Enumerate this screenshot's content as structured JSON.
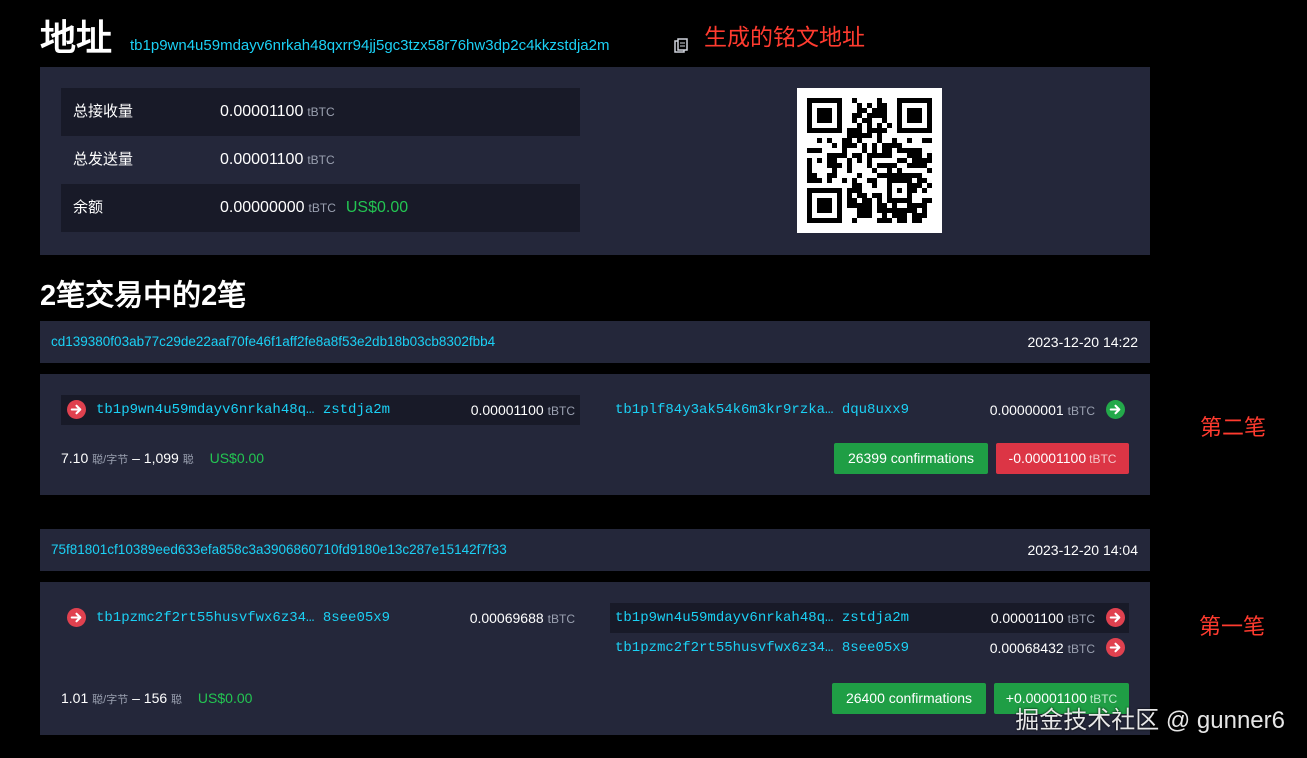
{
  "header": {
    "title": "地址",
    "address": "tb1p9wn4u59mdayv6nrkah48qxrr94jj5gc3tzx58r76hw3dp2c4kkzstdja2m",
    "annotation": "生成的铭文地址"
  },
  "summary": {
    "rows": [
      {
        "label": "总接收量",
        "value": "0.00001100",
        "unit": "tBTC",
        "usd": ""
      },
      {
        "label": "总发送量",
        "value": "0.00001100",
        "unit": "tBTC",
        "usd": ""
      },
      {
        "label": "余额",
        "value": "0.00000000",
        "unit": "tBTC",
        "usd": "US$0.00"
      }
    ]
  },
  "tx_heading": "2笔交易中的2笔",
  "transactions": [
    {
      "txid": "cd139380f03ab77c29de22aaf70fe46f1aff2fe8a8f53e2db18b03cb8302fbb4",
      "time": "2023-12-20 14:22",
      "inputs": [
        {
          "addr_head": "tb1p9wn4u59mdayv6nrkah48q…",
          "addr_tail": "zstdja2m",
          "amount": "0.00001100",
          "unit": "tBTC"
        }
      ],
      "outputs": [
        {
          "addr_head": "tb1plf84y3ak54k6m3kr9rzka…",
          "addr_tail": "dqu8uxx9",
          "amount": "0.00000001",
          "unit": "tBTC"
        }
      ],
      "fee_rate": "7.10",
      "fee_rate_unit": "聪/字节",
      "fee_sep": "–",
      "fee": "1,099",
      "fee_unit": "聪",
      "fee_usd": "US$0.00",
      "confirmations": "26399 confirmations",
      "delta": "-0.00001100",
      "delta_unit": "tBTC",
      "annotation": "第二笔"
    },
    {
      "txid": "75f81801cf10389eed633efa858c3a3906860710fd9180e13c287e15142f7f33",
      "time": "2023-12-20 14:04",
      "inputs": [
        {
          "addr_head": "tb1pzmc2f2rt55husvfwx6z34…",
          "addr_tail": "8see05x9",
          "amount": "0.00069688",
          "unit": "tBTC"
        }
      ],
      "outputs": [
        {
          "addr_head": "tb1p9wn4u59mdayv6nrkah48q…",
          "addr_tail": "zstdja2m",
          "amount": "0.00001100",
          "unit": "tBTC"
        },
        {
          "addr_head": "tb1pzmc2f2rt55husvfwx6z34…",
          "addr_tail": "8see05x9",
          "amount": "0.00068432",
          "unit": "tBTC"
        }
      ],
      "fee_rate": "1.01",
      "fee_rate_unit": "聪/字节",
      "fee_sep": "–",
      "fee": "156",
      "fee_unit": "聪",
      "fee_usd": "US$0.00",
      "confirmations": "26400 confirmations",
      "delta": "+0.00001100",
      "delta_unit": "tBTC",
      "annotation": "第一笔"
    }
  ],
  "watermark": "掘金技术社区 @ gunner6",
  "icons": {
    "copy": "copy-icon",
    "input_arrow": "arrow-right-circle-red-icon",
    "output_arrow_spent": "arrow-right-circle-red-icon",
    "output_arrow_unspent": "arrow-right-circle-green-icon"
  },
  "colors": {
    "background": "#000000",
    "panel": "#24273a",
    "panel_dark": "#181a28",
    "link": "#1bd1f5",
    "positive": "#1f9e45",
    "negative": "#dc3545",
    "annotation": "#ff3b2f"
  }
}
